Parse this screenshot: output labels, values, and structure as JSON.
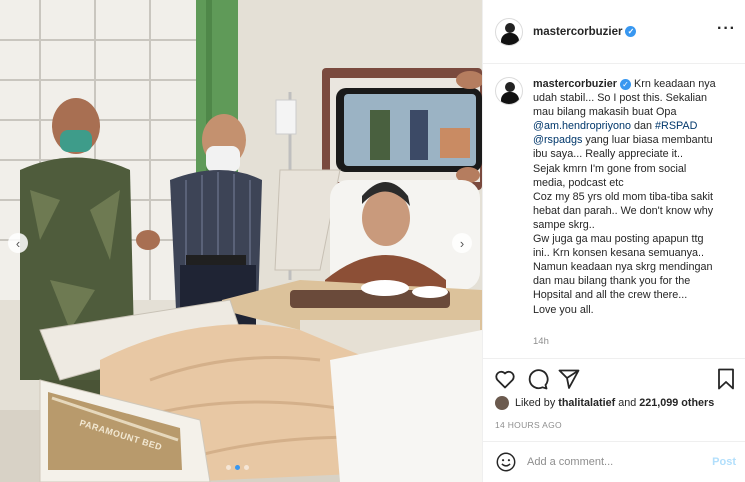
{
  "post": {
    "username": "mastercorbuzier",
    "verified_icon": "verified-badge-icon",
    "more_icon": "more-options-icon",
    "caption_user": "mastercorbuzier",
    "caption": {
      "l1": "Krn keadaan nya",
      "l2": "udah stabil... So I post this. Sekalian",
      "l3": "mau bilang makasih buat Opa",
      "l4_tag": "@am.hendropriyono",
      "l4_mid": " dan ",
      "l4_tag2": "#RSPAD",
      "l5_tag": "@rspadgs",
      "l5_rest": " yang luar biasa membantu",
      "l6": "ibu saya... Really appreciate it..",
      "l7": "Sejak kmrn I'm gone from social",
      "l8": "media, podcast etc",
      "l9": "Coz my 85 yrs old mom tiba-tiba sakit",
      "l10": "hebat dan parah.. We don't know why",
      "l11": "sampe skrg..",
      "l12": "Gw juga ga mau posting apapun ttg",
      "l13": "ini.. Krn konsen kesana semuanya..",
      "l14": "Namun keadaan nya skrg mendingan",
      "l15": "dan mau bilang thank you for the",
      "l16": "Hopsital and all the crew there...",
      "l17": "Love you all."
    },
    "caption_age": "14h",
    "likes_prefix": "Liked by ",
    "likes_user": "thalitalatief",
    "likes_mid": " and ",
    "likes_count": "221,099 others",
    "time_ago": "14 HOURS AGO",
    "comment_placeholder": "Add a comment...",
    "post_label": "Post"
  },
  "photo": {
    "bed_brand": "PARAMOUNT BED",
    "carousel_slides": 3,
    "active_slide": 2
  },
  "colors": {
    "link": "#00376b",
    "accent": "#3897f0",
    "post_disabled": "#b2dffc",
    "muted": "#8e8e8e"
  }
}
